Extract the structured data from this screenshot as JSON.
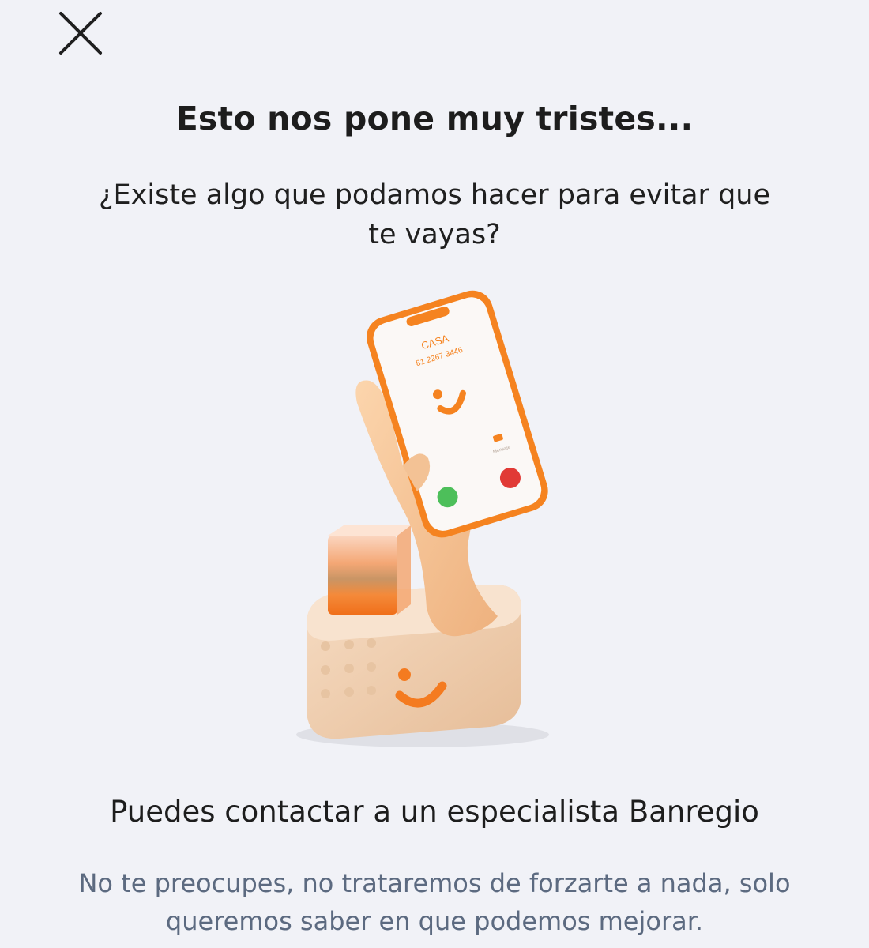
{
  "header": {
    "close_icon": "close-icon"
  },
  "content": {
    "title": "Esto nos pone muy tristes...",
    "subtitle": "¿Existe algo que podamos hacer para evitar que te vayas?",
    "illustration": {
      "phone_contact_name": "CASA",
      "phone_number": "81 2267 3446",
      "phone_message_label": "Mensaje"
    },
    "contact_text": "Puedes contactar a un especialista Banregio",
    "reassure_text": "No te preocupes, no trataremos de forzarte a nada, solo queremos saber en que podemos mejorar."
  },
  "colors": {
    "background": "#f1f2f7",
    "accent_orange": "#f47b20",
    "muted_text": "#5c6a80"
  }
}
